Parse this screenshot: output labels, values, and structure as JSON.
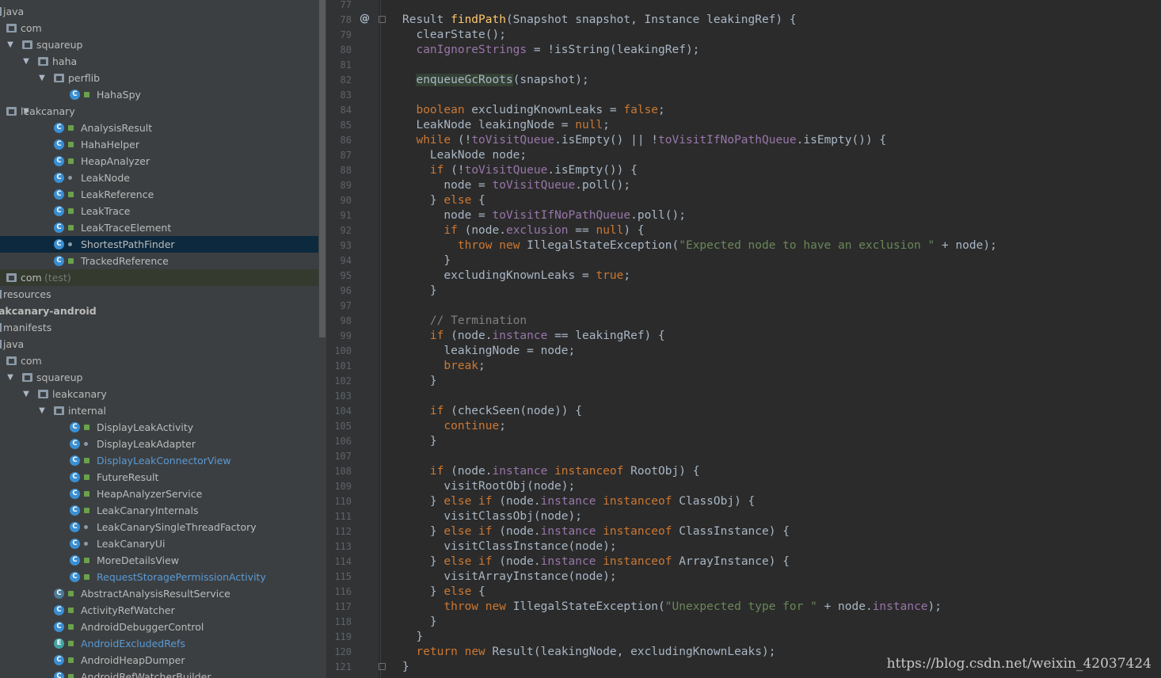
{
  "tree": {
    "rows": [
      {
        "label": "java",
        "arrow": "",
        "icon": "none"
      },
      {
        "label": "com",
        "arrow": "",
        "icon": "folder"
      },
      {
        "label": "squareup",
        "arrow": "▼",
        "icon": "folder"
      },
      {
        "label": "haha",
        "arrow": "▼",
        "icon": "folder"
      },
      {
        "label": "perflib",
        "arrow": "▼",
        "icon": "folder"
      },
      {
        "label": "HahaSpy",
        "icon": "class"
      },
      {
        "label": "leakcanary",
        "arrow": "▼",
        "icon": "folder"
      },
      {
        "label": "AnalysisResult",
        "icon": "class"
      },
      {
        "label": "HahaHelper",
        "icon": "class"
      },
      {
        "label": "HeapAnalyzer",
        "icon": "class"
      },
      {
        "label": "LeakNode",
        "icon": "class"
      },
      {
        "label": "LeakReference",
        "icon": "class"
      },
      {
        "label": "LeakTrace",
        "icon": "class"
      },
      {
        "label": "LeakTraceElement",
        "icon": "class"
      },
      {
        "label": "ShortestPathFinder",
        "icon": "class",
        "selected": true
      },
      {
        "label": "TrackedReference",
        "icon": "class"
      },
      {
        "label": "com",
        "suffix": "(test)",
        "icon": "folder"
      },
      {
        "label": "resources",
        "icon": "none"
      },
      {
        "label": "akcanary-android",
        "icon": "none",
        "bold": true
      },
      {
        "label": "manifests",
        "icon": "none"
      },
      {
        "label": "java",
        "icon": "none"
      },
      {
        "label": "com",
        "icon": "folder"
      },
      {
        "label": "squareup",
        "arrow": "▼",
        "icon": "folder"
      },
      {
        "label": "leakcanary",
        "arrow": "▼",
        "icon": "folder"
      },
      {
        "label": "internal",
        "arrow": "▼",
        "icon": "folder"
      },
      {
        "label": "DisplayLeakActivity",
        "icon": "class"
      },
      {
        "label": "DisplayLeakAdapter",
        "icon": "class"
      },
      {
        "label": "DisplayLeakConnectorView",
        "icon": "class",
        "blue": true
      },
      {
        "label": "FutureResult",
        "icon": "class"
      },
      {
        "label": "HeapAnalyzerService",
        "icon": "class"
      },
      {
        "label": "LeakCanaryInternals",
        "icon": "class"
      },
      {
        "label": "LeakCanarySingleThreadFactory",
        "icon": "class"
      },
      {
        "label": "LeakCanaryUi",
        "icon": "class"
      },
      {
        "label": "MoreDetailsView",
        "icon": "class"
      },
      {
        "label": "RequestStoragePermissionActivity",
        "icon": "class",
        "blue": true
      },
      {
        "label": "AbstractAnalysisResultService",
        "icon": "abstract"
      },
      {
        "label": "ActivityRefWatcher",
        "icon": "class"
      },
      {
        "label": "AndroidDebuggerControl",
        "icon": "class"
      },
      {
        "label": "AndroidExcludedRefs",
        "icon": "enum",
        "blue": true
      },
      {
        "label": "AndroidHeapDumper",
        "icon": "class"
      },
      {
        "label": "AndroidRefWatcherBuilder",
        "icon": "class"
      }
    ]
  },
  "editor": {
    "gutter_marker": "@",
    "lines": [
      {
        "n": "77",
        "code": ""
      },
      {
        "n": "78",
        "code": "Result findPath(Snapshot snapshot, Instance leakingRef) {"
      },
      {
        "n": "79",
        "code": "  clearState();"
      },
      {
        "n": "80",
        "code": "  canIgnoreStrings = !isString(leakingRef);"
      },
      {
        "n": "81",
        "code": ""
      },
      {
        "n": "82",
        "code": "  enqueueGcRoots(snapshot);"
      },
      {
        "n": "83",
        "code": ""
      },
      {
        "n": "84",
        "code": "  boolean excludingKnownLeaks = false;"
      },
      {
        "n": "85",
        "code": "  LeakNode leakingNode = null;"
      },
      {
        "n": "86",
        "code": "  while (!toVisitQueue.isEmpty() || !toVisitIfNoPathQueue.isEmpty()) {"
      },
      {
        "n": "87",
        "code": "    LeakNode node;"
      },
      {
        "n": "88",
        "code": "    if (!toVisitQueue.isEmpty()) {"
      },
      {
        "n": "89",
        "code": "      node = toVisitQueue.poll();"
      },
      {
        "n": "90",
        "code": "    } else {"
      },
      {
        "n": "91",
        "code": "      node = toVisitIfNoPathQueue.poll();"
      },
      {
        "n": "92",
        "code": "      if (node.exclusion == null) {"
      },
      {
        "n": "93",
        "code": "        throw new IllegalStateException(\"Expected node to have an exclusion \" + node);"
      },
      {
        "n": "94",
        "code": "      }"
      },
      {
        "n": "95",
        "code": "      excludingKnownLeaks = true;"
      },
      {
        "n": "96",
        "code": "    }"
      },
      {
        "n": "97",
        "code": ""
      },
      {
        "n": "98",
        "code": "    // Termination"
      },
      {
        "n": "99",
        "code": "    if (node.instance == leakingRef) {"
      },
      {
        "n": "100",
        "code": "      leakingNode = node;"
      },
      {
        "n": "101",
        "code": "      break;"
      },
      {
        "n": "102",
        "code": "    }"
      },
      {
        "n": "103",
        "code": ""
      },
      {
        "n": "104",
        "code": "    if (checkSeen(node)) {"
      },
      {
        "n": "105",
        "code": "      continue;"
      },
      {
        "n": "106",
        "code": "    }"
      },
      {
        "n": "107",
        "code": ""
      },
      {
        "n": "108",
        "code": "    if (node.instance instanceof RootObj) {"
      },
      {
        "n": "109",
        "code": "      visitRootObj(node);"
      },
      {
        "n": "110",
        "code": "    } else if (node.instance instanceof ClassObj) {"
      },
      {
        "n": "111",
        "code": "      visitClassObj(node);"
      },
      {
        "n": "112",
        "code": "    } else if (node.instance instanceof ClassInstance) {"
      },
      {
        "n": "113",
        "code": "      visitClassInstance(node);"
      },
      {
        "n": "114",
        "code": "    } else if (node.instance instanceof ArrayInstance) {"
      },
      {
        "n": "115",
        "code": "      visitArrayInstance(node);"
      },
      {
        "n": "116",
        "code": "    } else {"
      },
      {
        "n": "117",
        "code": "      throw new IllegalStateException(\"Unexpected type for \" + node.instance);"
      },
      {
        "n": "118",
        "code": "    }"
      },
      {
        "n": "119",
        "code": "  }"
      },
      {
        "n": "120",
        "code": "  return new Result(leakingNode, excludingKnownLeaks);"
      },
      {
        "n": "121",
        "code": "}"
      }
    ]
  },
  "watermark": "https://blog.csdn.net/weixin_42037424",
  "colors": {
    "keyword": "#cc7832",
    "method_decl": "#ffc66d",
    "field": "#9876aa",
    "string": "#6a8759",
    "comment": "#808080",
    "text": "#a9b7c6",
    "selection": "#0d293e"
  }
}
